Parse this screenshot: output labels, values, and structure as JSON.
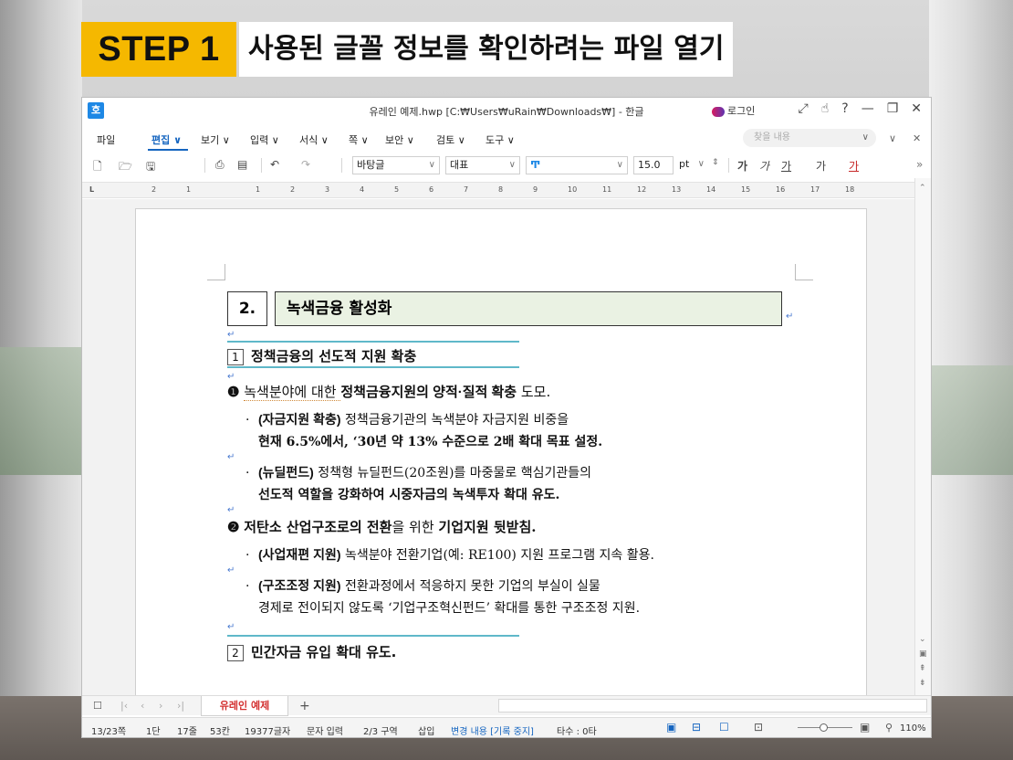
{
  "heading": {
    "step_label": "STEP 1",
    "title": "사용된 글꼴 정보를 확인하려는 파일 열기"
  },
  "window": {
    "title": "유레인 예제.hwp [C:₩Users₩uRain₩Downloads₩] - 한글",
    "logo": "호",
    "login_label": "로그인",
    "controls": [
      "⤢",
      "☝",
      "?",
      "—",
      "❐",
      "✕"
    ]
  },
  "menubar": {
    "items": [
      "파일",
      "편집 ∨",
      "보기 ∨",
      "입력 ∨",
      "서식 ∨",
      "쪽 ∨",
      "보안 ∨",
      "검토 ∨",
      "도구 ∨"
    ],
    "find_placeholder": "찾을 내용"
  },
  "toolbar": {
    "style_value": "바탕글",
    "lang_value": "대표",
    "font_value": "",
    "size_value": "15.0",
    "unit_value": "pt",
    "format_buttons": [
      "가",
      "가",
      "가",
      "가",
      "가"
    ]
  },
  "ruler": {
    "labels": [
      "2",
      "1",
      "1",
      "2",
      "3",
      "4",
      "5",
      "6",
      "7",
      "8",
      "9",
      "10",
      "11",
      "12",
      "13",
      "14",
      "15",
      "16",
      "17",
      "18"
    ]
  },
  "document": {
    "section_number": "2.",
    "section_title": "녹색금융 활성화",
    "sub1": {
      "num": "1",
      "title": "정책금융의 선도적 지원 확충"
    },
    "item1": {
      "marker": "❶",
      "text_a": "녹색분야에 대한 ",
      "text_b": "정책금융지원의 양적·질적 확충",
      "text_c": " 도모."
    },
    "bullet1": {
      "head": "(자금지원 확충)",
      "line1": " 정책금융기관의 녹색분야 자금지원 비중을",
      "line2": "현재 6.5%에서, ‘30년 약 13% 수준으로 2배 확대 목표 설정."
    },
    "bullet2": {
      "head": "(뉴딜펀드)",
      "line1": " 정책형 뉴딜펀드(20조원)를 마중물로 핵심기관들의",
      "line2": "선도적 역할을 강화하여 시중자금의 녹색투자 확대 유도."
    },
    "item2": {
      "marker": "❷",
      "text_a": "저탄소 산업구조로의 전환",
      "text_b": "을 위한 ",
      "text_c": "기업지원 뒷받침."
    },
    "bullet3": {
      "head": "(사업재편 지원)",
      "line1": " 녹색분야 전환기업(예: RE100) 지원 프로그램 지속 활용."
    },
    "bullet4": {
      "head": "(구조조정 지원)",
      "line1": " 전환과정에서 적응하지 못한 기업의 부실이 실물",
      "line2": "경제로 전이되지 않도록 ‘기업구조혁신펀드’ 확대를 통한 구조조정 지원."
    },
    "sub2": {
      "num": "2",
      "title": "민간자금 유입 확대 유도."
    }
  },
  "tabs": {
    "active": "유레인 예제",
    "add": "+"
  },
  "status": {
    "page": "13/23쪽",
    "column": "1단",
    "line": "17줄",
    "col": "53칸",
    "chars": "19377글자",
    "mode": "문자 입력",
    "section": "2/3 구역",
    "insert": "삽입",
    "track": "변경 내용 [기록 중지]",
    "typing": "타수 : 0타",
    "zoom": "110%"
  }
}
